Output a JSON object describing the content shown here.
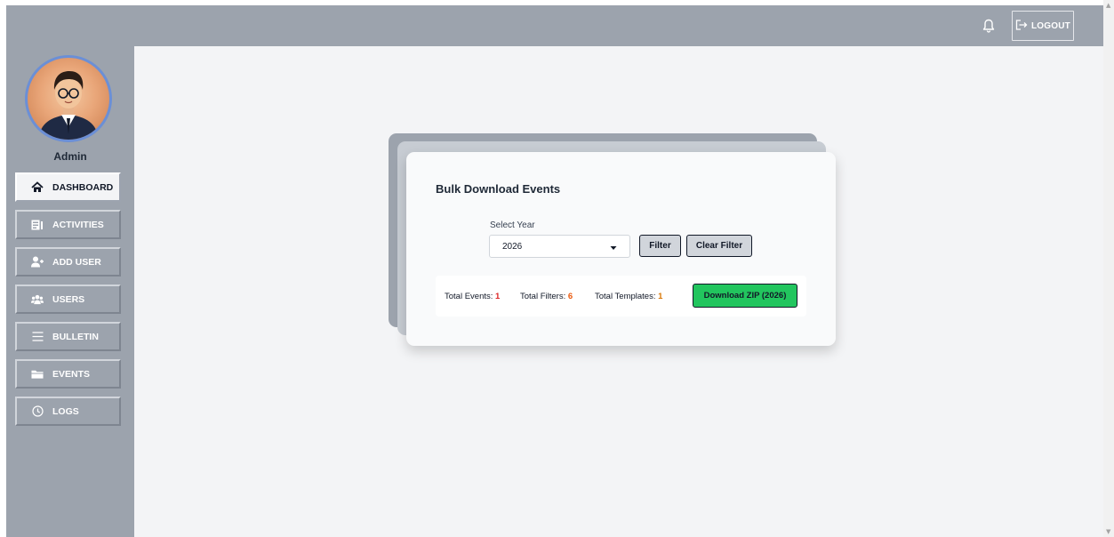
{
  "header": {
    "logout_label": "LOGOUT",
    "bell_icon": "bell-icon",
    "logout_icon": "logout-icon"
  },
  "sidebar": {
    "user_name": "Admin",
    "items": [
      {
        "label": "DASHBOARD",
        "icon": "home-icon",
        "active": true
      },
      {
        "label": "ACTIVITIES",
        "icon": "activities-icon",
        "active": false
      },
      {
        "label": "ADD USER",
        "icon": "add-user-icon",
        "active": false
      },
      {
        "label": "USERS",
        "icon": "users-icon",
        "active": false
      },
      {
        "label": "BULLETIN",
        "icon": "menu-icon",
        "active": false
      },
      {
        "label": "EVENTS",
        "icon": "folder-icon",
        "active": false
      },
      {
        "label": "LOGS",
        "icon": "clock-icon",
        "active": false
      }
    ]
  },
  "card": {
    "title": "Bulk Download Events",
    "select_label": "Select Year",
    "selected_year": "2026",
    "filter_label": "Filter",
    "clear_filter_label": "Clear Filter",
    "stats": {
      "events_label": "Total Events:",
      "events_value": "1",
      "filters_label": "Total Filters:",
      "filters_value": "6",
      "templates_label": "Total Templates:",
      "templates_value": "1"
    },
    "download_label": "Download ZIP (2026)"
  },
  "colors": {
    "sidebar_bg": "#9ca3ad",
    "main_bg": "#f3f4f6",
    "download_green": "#22c55e",
    "events_red": "#dc2626",
    "filters_orange": "#ea580c",
    "templates_amber": "#d97706"
  }
}
